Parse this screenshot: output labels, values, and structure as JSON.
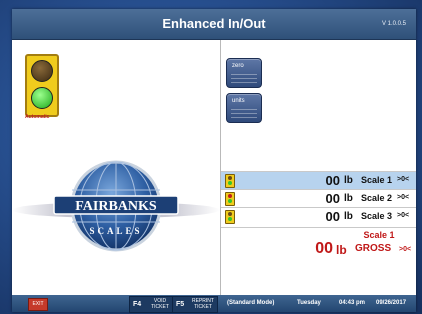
{
  "app": {
    "title": "Enhanced In/Out",
    "version": "V 1.0.0.5"
  },
  "traffic_light": {
    "label": "Automatic",
    "active": "green"
  },
  "logo": {
    "line1": "FAIRBANKS",
    "line2": "SCALES"
  },
  "buttons": {
    "zero": "zero",
    "units": "units"
  },
  "scales": [
    {
      "value": "00",
      "unit": "lb",
      "name": "Scale 1",
      "zero_mark": ">0<",
      "selected": true
    },
    {
      "value": "00",
      "unit": "lb",
      "name": "Scale 2",
      "zero_mark": ">0<",
      "selected": false
    },
    {
      "value": "00",
      "unit": "lb",
      "name": "Scale 3",
      "zero_mark": ">0<",
      "selected": false
    }
  ],
  "total": {
    "value": "00",
    "unit": "lb",
    "name": "Scale 1",
    "mode": "GROSS",
    "zero_mark": ">0<"
  },
  "statusbar": {
    "exit": "EXIT",
    "f4": {
      "key": "F4",
      "text": "VOID TICKET"
    },
    "f5": {
      "key": "F5",
      "text": "REPRINT TICKET"
    },
    "mode": "(Standard Mode)",
    "day": "Tuesday",
    "time": "04:43 pm",
    "date": "09/26/2017"
  },
  "colors": {
    "accent": "#2f5179",
    "total_red": "#c01818",
    "selected_row": "#b7d3ee"
  }
}
